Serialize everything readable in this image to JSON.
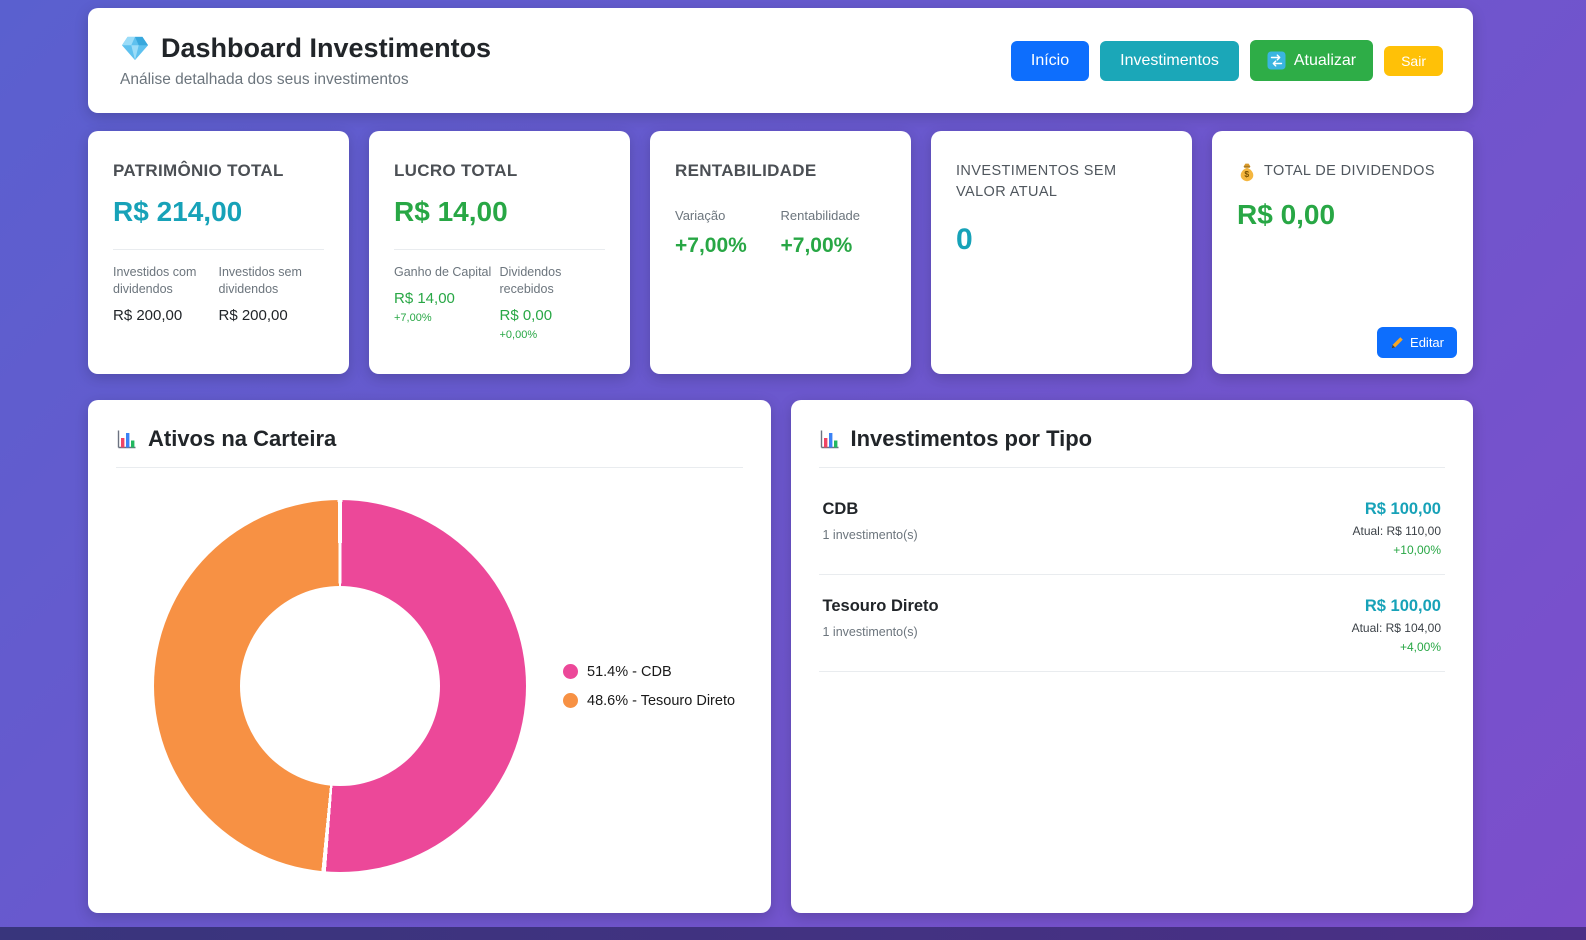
{
  "colors": {
    "teal": "#17a2b8",
    "green": "#28a745",
    "blue": "#0d6efd",
    "yellow": "#ffc107"
  },
  "header": {
    "icon": "diamond-icon",
    "title": "Dashboard Investimentos",
    "subtitle": "Análise detalhada dos seus investimentos",
    "nav": {
      "inicio": "Início",
      "investimentos": "Investimentos",
      "atualizar_icon": "currency-exchange-icon",
      "atualizar": "Atualizar",
      "sair": "Sair"
    }
  },
  "stats": {
    "patrimonio": {
      "title": "PATRIMÔNIO TOTAL",
      "value": "R$ 214,00",
      "cols": [
        {
          "label": "Investidos com dividendos",
          "value": "R$ 200,00"
        },
        {
          "label": "Investidos sem dividendos",
          "value": "R$ 200,00"
        }
      ]
    },
    "lucro": {
      "title": "LUCRO TOTAL",
      "value": "R$ 14,00",
      "cols": [
        {
          "label": "Ganho de Capital",
          "value": "R$ 14,00",
          "pct": "+7,00%"
        },
        {
          "label": "Dividendos recebidos",
          "value": "R$ 0,00",
          "pct": "+0,00%"
        }
      ]
    },
    "rentabilidade": {
      "title": "RENTABILIDADE",
      "cols": [
        {
          "label": "Variação",
          "value": "+7,00%"
        },
        {
          "label": "Rentabilidade",
          "value": "+7,00%"
        }
      ]
    },
    "sem_valor_atual": {
      "title": "INVESTIMENTOS SEM VALOR ATUAL",
      "value": "0"
    },
    "dividendos": {
      "icon": "money-bag-icon",
      "title": "TOTAL DE DIVIDENDOS",
      "value": "R$ 0,00",
      "edit": {
        "icon": "pencil-icon",
        "label": "Editar"
      }
    }
  },
  "portfolio": {
    "icon": "bar-chart-icon",
    "title": "Ativos na Carteira",
    "chart_data": {
      "type": "pie",
      "donut": true,
      "segments": [
        {
          "label": "CDB",
          "value": 51.4,
          "color": "#ec4899",
          "legend": "51.4% - CDB"
        },
        {
          "label": "Tesouro Direto",
          "value": 48.6,
          "color": "#f79144",
          "legend": "48.6% - Tesouro Direto"
        }
      ]
    }
  },
  "by_type": {
    "icon": "bar-chart-icon",
    "title": "Investimentos por Tipo",
    "rows": [
      {
        "name": "CDB",
        "count": "1 investimento(s)",
        "value": "R$ 100,00",
        "current": "Atual: R$ 110,00",
        "pct": "+10,00%"
      },
      {
        "name": "Tesouro Direto",
        "count": "1 investimento(s)",
        "value": "R$ 100,00",
        "current": "Atual: R$ 104,00",
        "pct": "+4,00%"
      }
    ]
  }
}
